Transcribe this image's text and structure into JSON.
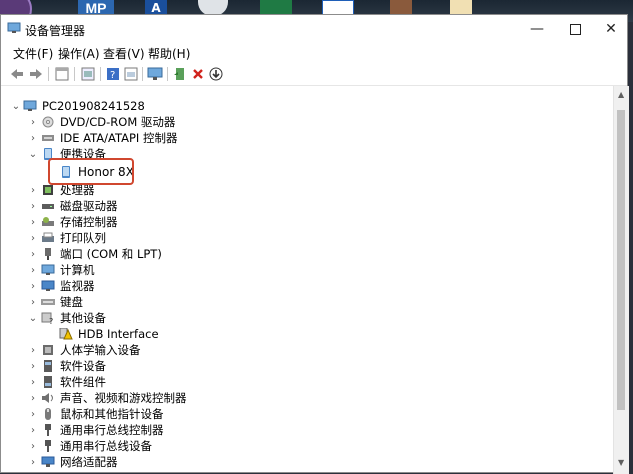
{
  "window": {
    "title": "设备管理器",
    "controls": {
      "minimize": "—",
      "maximize": "",
      "close": "✕"
    }
  },
  "menu": [
    "文件(F)",
    "操作(A)",
    "查看(V)",
    "帮助(H)"
  ],
  "desktop": {
    "mp_label": "MP",
    "a_label": "A"
  },
  "tree": {
    "root": "PC201908241528",
    "items": [
      {
        "label": "DVD/CD-ROM 驱动器",
        "state": "collapsed",
        "icon": "dvd-icon"
      },
      {
        "label": "IDE ATA/ATAPI 控制器",
        "state": "collapsed",
        "icon": "ide-icon"
      },
      {
        "label": "便携设备",
        "state": "expanded",
        "icon": "portable-icon",
        "children": [
          {
            "label": "Honor 8X",
            "icon": "phone-icon"
          }
        ]
      },
      {
        "label": "处理器",
        "state": "collapsed",
        "icon": "cpu-icon"
      },
      {
        "label": "磁盘驱动器",
        "state": "collapsed",
        "icon": "disk-icon"
      },
      {
        "label": "存储控制器",
        "state": "collapsed",
        "icon": "storage-icon"
      },
      {
        "label": "打印队列",
        "state": "collapsed",
        "icon": "printer-icon"
      },
      {
        "label": "端口 (COM 和 LPT)",
        "state": "collapsed",
        "icon": "port-icon"
      },
      {
        "label": "计算机",
        "state": "collapsed",
        "icon": "computer-icon"
      },
      {
        "label": "监视器",
        "state": "collapsed",
        "icon": "monitor-icon"
      },
      {
        "label": "键盘",
        "state": "collapsed",
        "icon": "keyboard-icon"
      },
      {
        "label": "其他设备",
        "state": "expanded",
        "icon": "other-device-icon",
        "children": [
          {
            "label": "HDB Interface",
            "icon": "unknown-device-icon"
          }
        ]
      },
      {
        "label": "人体学输入设备",
        "state": "collapsed",
        "icon": "hid-icon"
      },
      {
        "label": "软件设备",
        "state": "collapsed",
        "icon": "software-device-icon"
      },
      {
        "label": "软件组件",
        "state": "collapsed",
        "icon": "software-component-icon"
      },
      {
        "label": "声音、视频和游戏控制器",
        "state": "collapsed",
        "icon": "sound-icon"
      },
      {
        "label": "鼠标和其他指针设备",
        "state": "collapsed",
        "icon": "mouse-icon"
      },
      {
        "label": "通用串行总线控制器",
        "state": "collapsed",
        "icon": "usb-icon"
      },
      {
        "label": "通用串行总线设备",
        "state": "collapsed",
        "icon": "usb-device-icon"
      },
      {
        "label": "网络适配器",
        "state": "collapsed",
        "icon": "network-icon"
      }
    ]
  },
  "colors": {
    "highlight_border": "#d0472f",
    "device_blue": "#4a86c8"
  }
}
